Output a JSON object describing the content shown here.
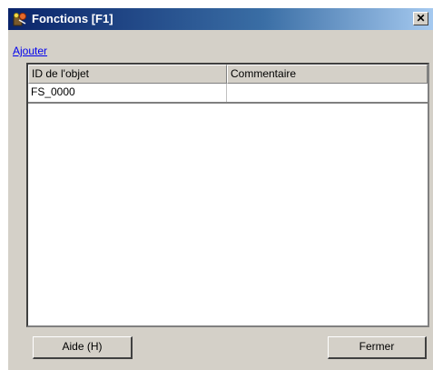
{
  "window": {
    "title": "Fonctions [F1]",
    "icon": "functions-app-icon",
    "close_glyph": "✕"
  },
  "toolbar": {
    "add_link": "Ajouter"
  },
  "table": {
    "columns": [
      "ID de l'objet",
      "Commentaire"
    ],
    "rows": [
      [
        "FS_0000",
        ""
      ]
    ]
  },
  "buttons": {
    "help": "Aide (H)",
    "close": "Fermer"
  },
  "colors": {
    "titlebar_start": "#0a246a",
    "titlebar_end": "#a6caf0",
    "dialog_bg": "#d4d0c8",
    "link": "#0000ee"
  }
}
